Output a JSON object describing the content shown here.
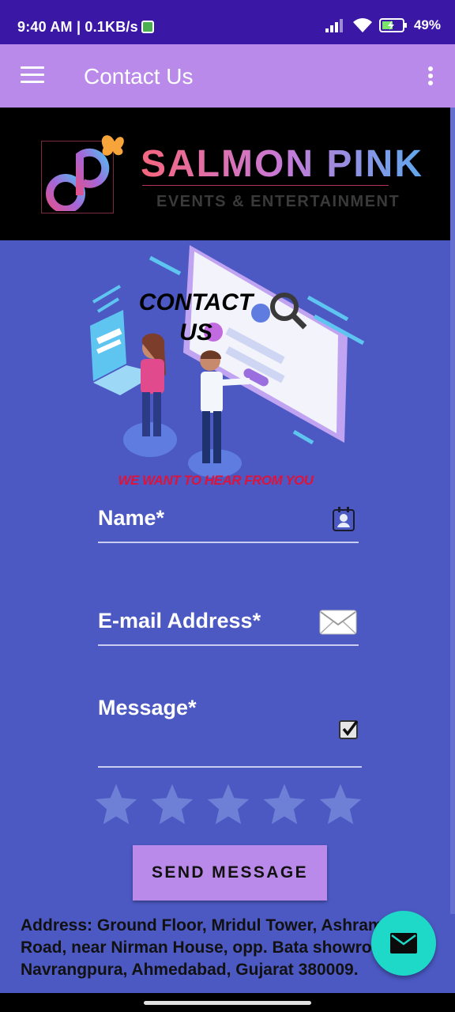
{
  "status_bar": {
    "time": "9:40 AM | 0.1KB/s",
    "battery": "49%"
  },
  "app_bar": {
    "title": "Contact Us"
  },
  "banner": {
    "brand": "SALMON PINK",
    "tagline": "EVENTS & ENTERTAINMENT"
  },
  "hero": {
    "heading_line1": "CONTACT",
    "heading_line2": "US",
    "subheading": "WE WANT TO HEAR FROM YOU"
  },
  "form": {
    "name_label": "Name*",
    "email_label": "E-mail Address*",
    "message_label": "Message*"
  },
  "rating": {
    "value": 0,
    "max": 5
  },
  "send_button": "SEND MESSAGE",
  "address": "Address: Ground Floor, Mridul Tower, Ashram Road, near Nirman House, opp. Bata showroom, Navrangpura, Ahmedabad, Gujarat 380009.",
  "colors": {
    "status_bar": "#3b17a6",
    "app_bar": "#b98ae9",
    "background": "#4c59c3",
    "accent_red": "#dc143c",
    "fab": "#1fd9c8"
  },
  "icons": {
    "menu": "menu-icon",
    "more": "more-vert-icon",
    "name": "contact-card-icon",
    "email": "envelope-icon",
    "message": "checkbox-icon",
    "fab": "mail-icon"
  }
}
